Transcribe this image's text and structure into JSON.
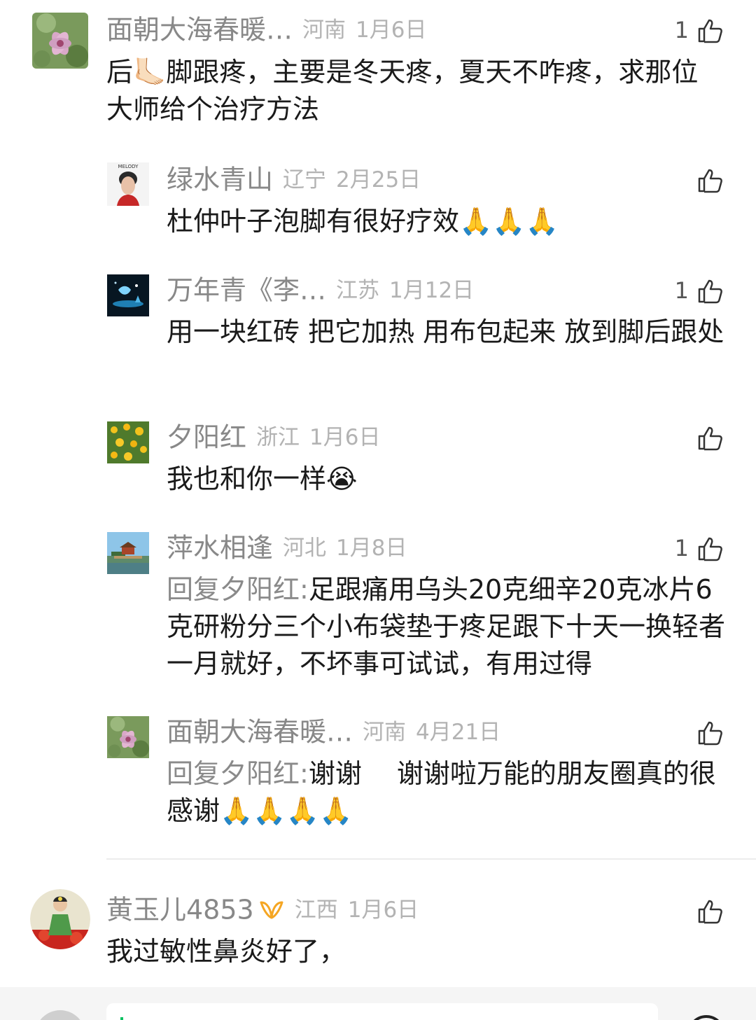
{
  "comments": [
    {
      "name": "面朝大海春暖…",
      "location": "河南",
      "date": "1月6日",
      "likes": "1",
      "text": "后🦶🏻脚跟疼，主要是冬天疼，夏天不咋疼，求那位大师给个治疗方法",
      "avatar_icon": "flower-avatar-icon"
    },
    {
      "name": "绿水青山",
      "location": "辽宁",
      "date": "2月25日",
      "likes": "",
      "text": "杜仲叶子泡脚有很好疗效🙏🙏🙏",
      "avatar_icon": "person-avatar-icon",
      "avatar_caption": "MELODY"
    },
    {
      "name": "万年青《李…",
      "location": "江苏",
      "date": "1月12日",
      "likes": "1",
      "text": "用一块红砖 把它加热 用布包起来 放到脚后跟处",
      "avatar_icon": "night-art-avatar-icon"
    },
    {
      "name": "夕阳红",
      "location": "浙江",
      "date": "1月6日",
      "likes": "",
      "text": "我也和你一样😭",
      "avatar_icon": "yellow-flowers-avatar-icon"
    },
    {
      "name": "萍水相逢",
      "location": "河北",
      "date": "1月8日",
      "likes": "1",
      "text": "回复夕阳红:足跟痛用乌头20克细辛20克冰片6克研粉分三个小布袋垫于疼足跟下十天一换轻者一月就好，不坏事可试试，有用过得",
      "reply_prefix": "回复夕阳红:",
      "reply_text": "足跟痛用乌头20克细辛20克冰片6克研粉分三个小布袋垫于疼足跟下十天一换轻者一月就好，不坏事可试试，有用过得",
      "avatar_icon": "palace-avatar-icon"
    },
    {
      "name": "面朝大海春暖…",
      "location": "河南",
      "date": "4月21日",
      "likes": "",
      "reply_prefix": "回复夕阳红:",
      "reply_text": "谢谢　 谢谢啦万能的朋友圈真的很感谢🙏🙏🙏🙏",
      "avatar_icon": "flower-avatar-icon"
    },
    {
      "name": "黄玉儿4853",
      "location": "江西",
      "date": "1月6日",
      "likes": "",
      "text": "我过敏性鼻炎好了，",
      "avatar_icon": "portrait-avatar-icon",
      "badge_icon": "vip-badge-icon"
    }
  ],
  "colors": {
    "name": "#888888",
    "meta": "#b3b3b3",
    "body": "#1a1a1a",
    "reply_prefix": "#8a8a8a",
    "vip_badge": "#f5a623",
    "accent": "#07c160"
  },
  "icons": {
    "like": "thumbs-up-icon"
  }
}
